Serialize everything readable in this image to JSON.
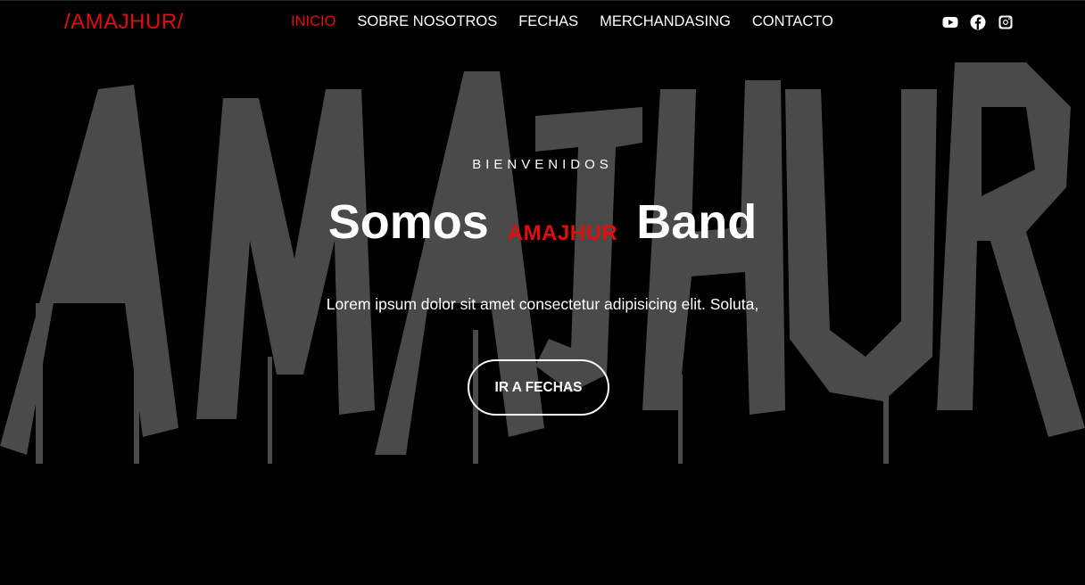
{
  "nav": {
    "logo": "/AMAJHUR/",
    "links": [
      {
        "label": "INICIO",
        "active": true
      },
      {
        "label": "SOBRE NOSOTROS",
        "active": false
      },
      {
        "label": "FECHAS",
        "active": false
      },
      {
        "label": "MERCHANDASING",
        "active": false
      },
      {
        "label": "CONTACTO",
        "active": false
      }
    ],
    "social_icons": [
      "youtube-icon",
      "facebook-icon",
      "instagram-icon"
    ]
  },
  "hero": {
    "background_word": "AMAJHUR",
    "welcome": "BIENVENIDOS",
    "headline_prefix": "Somos",
    "headline_band": "AMAJHUR",
    "headline_suffix": "Band",
    "lead": "Lorem ipsum dolor sit amet consectetur adipisicing elit. Soluta,",
    "cta_label": "IR A FECHAS"
  },
  "colors": {
    "accent": "#e10e0e",
    "background": "#000000",
    "brush_text": "#4a4a4a",
    "text": "#ffffff"
  }
}
